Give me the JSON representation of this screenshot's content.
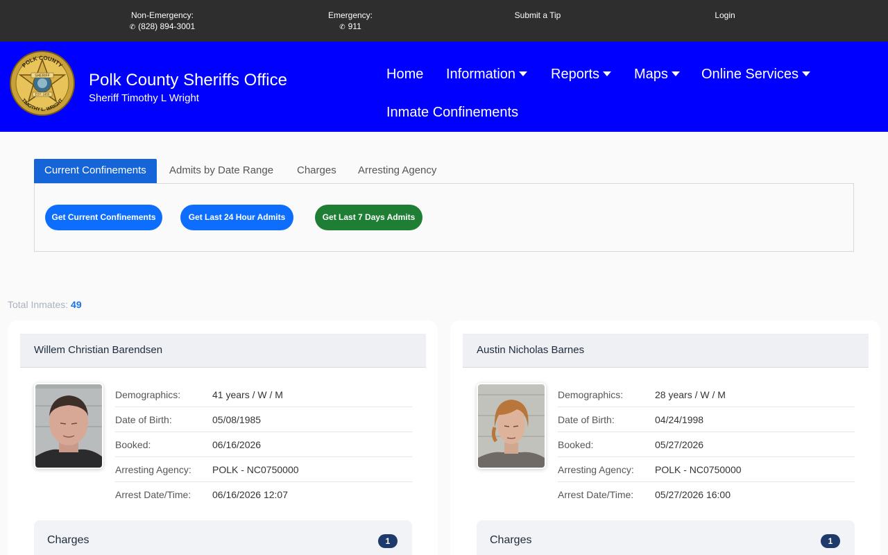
{
  "topbar": {
    "non_emergency_label": "Non-Emergency:",
    "non_emergency_phone": "(828) 894-3001",
    "emergency_label": "Emergency:",
    "emergency_phone": "911",
    "tip_label": "Submit a Tip",
    "login_label": "Login"
  },
  "header": {
    "badge_icon": "sheriff-star-badge-icon",
    "badge_text_top": "POLK COUNTY",
    "badge_text_bottom": "TIMOTHY L. WRIGHT",
    "badge_text_center": "SHERIFF",
    "badge_text_est": "EST. 1855",
    "title": "Polk County Sheriffs Office",
    "subtitle": "Sheriff Timothy L Wright",
    "background_color": "#0000ff"
  },
  "nav": {
    "home": "Home",
    "information": "Information",
    "reports": "Reports",
    "maps": "Maps",
    "online_services": "Online Services",
    "inmate_confinements": "Inmate Confinements"
  },
  "tabs": {
    "current_confinements": "Current Confinements",
    "admits_by_date_range": "Admits by Date Range",
    "charges": "Charges",
    "arresting_agency": "Arresting Agency"
  },
  "buttons": {
    "get_current": "Get Current Confinements",
    "get_24h": "Get Last 24 Hour Admits",
    "get_7d": "Get Last 7 Days Admits"
  },
  "summary": {
    "total_label": "Total Inmates:",
    "total_value": "49"
  },
  "labels": {
    "demographics": "Demographics:",
    "dob": "Date of Birth:",
    "booked": "Booked:",
    "agency": "Arresting Agency:",
    "arrest_datetime": "Arrest Date/Time:",
    "charges": "Charges"
  },
  "inmates": [
    {
      "name": "Willem Christian Barendsen",
      "demographics": "41 years / W / M",
      "dob": "05/08/1985",
      "booked": "06/16/2026",
      "agency": "POLK - NC0750000",
      "arrest_datetime": "06/16/2026 12:07",
      "charges_count": "1"
    },
    {
      "name": "Austin Nicholas Barnes",
      "demographics": "28 years / W / M",
      "dob": "04/24/1998",
      "booked": "05/27/2026",
      "agency": "POLK - NC0750000",
      "arrest_datetime": "05/27/2026 16:00",
      "charges_count": "1"
    }
  ]
}
